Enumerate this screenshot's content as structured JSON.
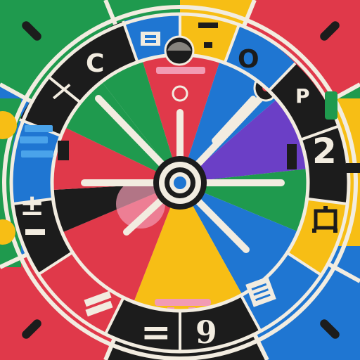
{
  "scene": {
    "description_colors": {
      "background": "#efe9dd",
      "red": "#e0394a",
      "green": "#1f9a4e",
      "yellow": "#f7be15",
      "blue": "#1f76d2",
      "purple": "#6b3fc6",
      "black": "#1c1c1c",
      "cream": "#f2ece0",
      "pink": "#f29bb3"
    },
    "ring_labels": {
      "top_left": "―",
      "top_c": "C",
      "top_o": "O",
      "top_p": "P",
      "right_2": "2",
      "left_plus_minus": "±",
      "bottom_equals": "=",
      "bottom_9": "9"
    },
    "icons": [
      "hub-target-icon",
      "pointer-knob-icon",
      "square-bracket-icon"
    ]
  }
}
